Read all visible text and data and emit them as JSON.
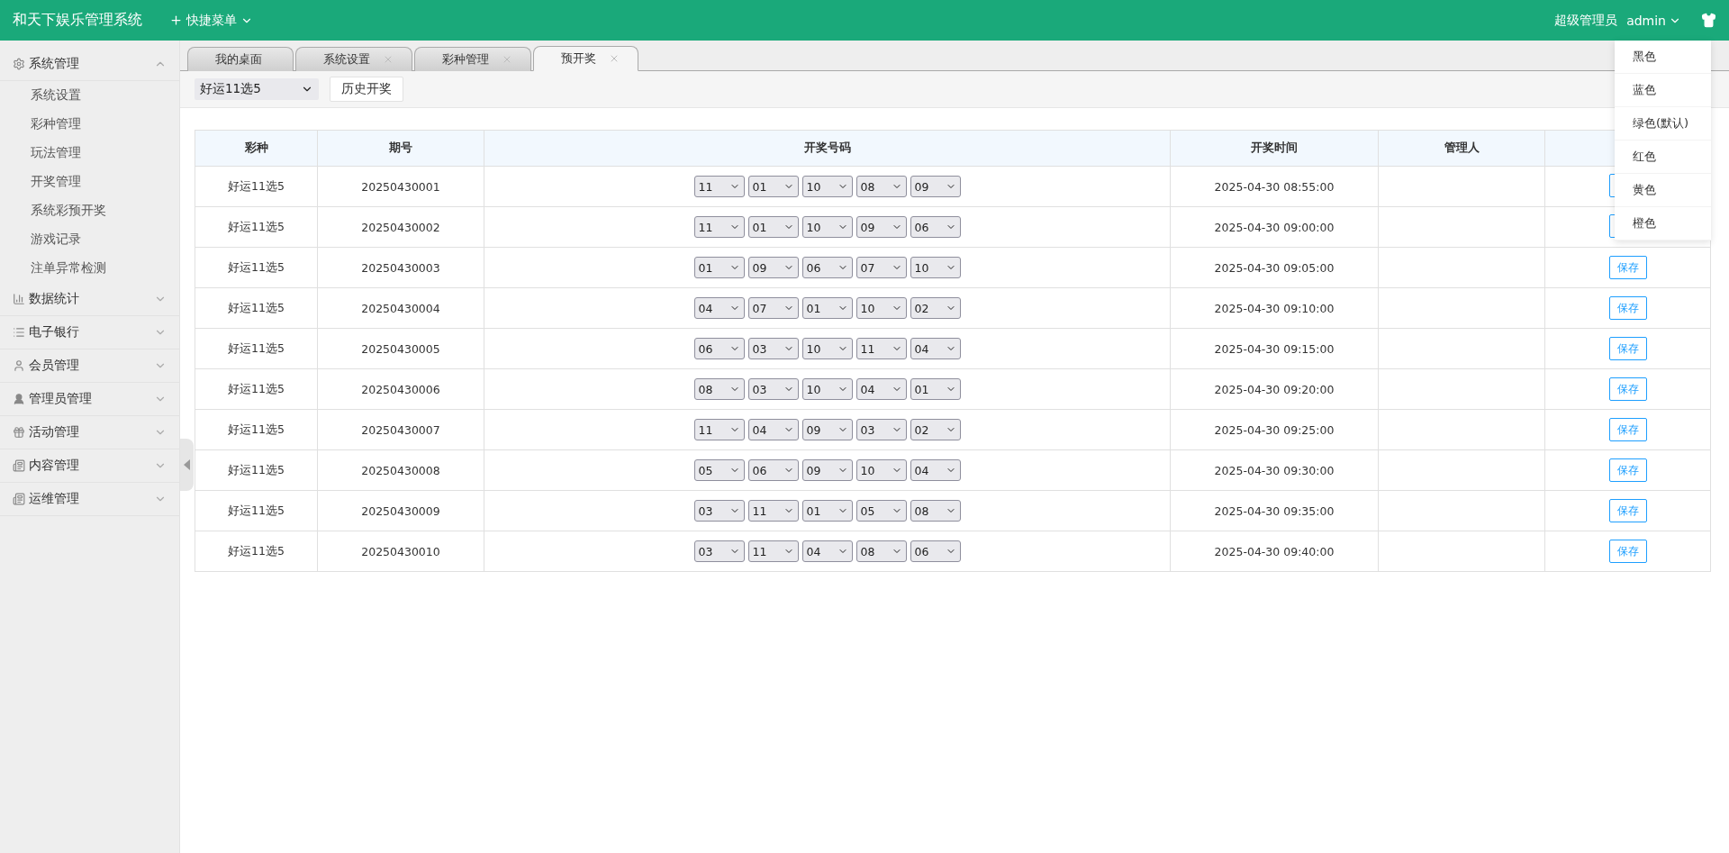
{
  "header": {
    "title": "和天下娱乐管理系统",
    "quick_menu": "快捷菜单",
    "role": "超级管理员",
    "user": "admin"
  },
  "theme_menu": [
    {
      "label": "黑色"
    },
    {
      "label": "蓝色"
    },
    {
      "label": "绿色(默认)"
    },
    {
      "label": "红色"
    },
    {
      "label": "黄色"
    },
    {
      "label": "橙色"
    }
  ],
  "sidebar": [
    {
      "label": "系统管理",
      "expanded": true,
      "children": [
        {
          "label": "系统设置"
        },
        {
          "label": "彩种管理"
        },
        {
          "label": "玩法管理"
        },
        {
          "label": "开奖管理"
        },
        {
          "label": "系统彩预开奖"
        },
        {
          "label": "游戏记录"
        },
        {
          "label": "注单异常检测"
        }
      ]
    },
    {
      "label": "数据统计",
      "expanded": false
    },
    {
      "label": "电子银行",
      "expanded": false
    },
    {
      "label": "会员管理",
      "expanded": false
    },
    {
      "label": "管理员管理",
      "expanded": false
    },
    {
      "label": "活动管理",
      "expanded": false
    },
    {
      "label": "内容管理",
      "expanded": false
    },
    {
      "label": "运维管理",
      "expanded": false
    }
  ],
  "tabs": [
    {
      "label": "我的桌面",
      "closable": false,
      "selected": false
    },
    {
      "label": "系统设置",
      "closable": true,
      "selected": false
    },
    {
      "label": "彩种管理",
      "closable": true,
      "selected": false
    },
    {
      "label": "预开奖",
      "closable": true,
      "selected": true
    }
  ],
  "toolbar": {
    "lottery": "好运11选5",
    "history_button": "历史开奖"
  },
  "table": {
    "columns": [
      "彩种",
      "期号",
      "开奖号码",
      "开奖时间",
      "管理人"
    ],
    "rows": [
      {
        "lottery": "好运11选5",
        "issue": "20250430001",
        "numbers": [
          "11",
          "01",
          "10",
          "08",
          "09"
        ],
        "time": "2025-04-30 08:55:00"
      },
      {
        "lottery": "好运11选5",
        "issue": "20250430002",
        "numbers": [
          "11",
          "01",
          "10",
          "09",
          "06"
        ],
        "time": "2025-04-30 09:00:00"
      },
      {
        "lottery": "好运11选5",
        "issue": "20250430003",
        "numbers": [
          "01",
          "09",
          "06",
          "07",
          "10"
        ],
        "time": "2025-04-30 09:05:00",
        "action": "保存"
      },
      {
        "lottery": "好运11选5",
        "issue": "20250430004",
        "numbers": [
          "04",
          "07",
          "01",
          "10",
          "02"
        ],
        "time": "2025-04-30 09:10:00",
        "action": "保存"
      },
      {
        "lottery": "好运11选5",
        "issue": "20250430005",
        "numbers": [
          "06",
          "03",
          "10",
          "11",
          "04"
        ],
        "time": "2025-04-30 09:15:00",
        "action": "保存"
      },
      {
        "lottery": "好运11选5",
        "issue": "20250430006",
        "numbers": [
          "08",
          "03",
          "10",
          "04",
          "01"
        ],
        "time": "2025-04-30 09:20:00",
        "action": "保存"
      },
      {
        "lottery": "好运11选5",
        "issue": "20250430007",
        "numbers": [
          "11",
          "04",
          "09",
          "03",
          "02"
        ],
        "time": "2025-04-30 09:25:00",
        "action": "保存"
      },
      {
        "lottery": "好运11选5",
        "issue": "20250430008",
        "numbers": [
          "05",
          "06",
          "09",
          "10",
          "04"
        ],
        "time": "2025-04-30 09:30:00",
        "action": "保存"
      },
      {
        "lottery": "好运11选5",
        "issue": "20250430009",
        "numbers": [
          "03",
          "11",
          "01",
          "05",
          "08"
        ],
        "time": "2025-04-30 09:35:00",
        "action": "保存"
      },
      {
        "lottery": "好运11选5",
        "issue": "20250430010",
        "numbers": [
          "03",
          "11",
          "04",
          "08",
          "06"
        ],
        "time": "2025-04-30 09:40:00",
        "action": "保存"
      }
    ]
  }
}
